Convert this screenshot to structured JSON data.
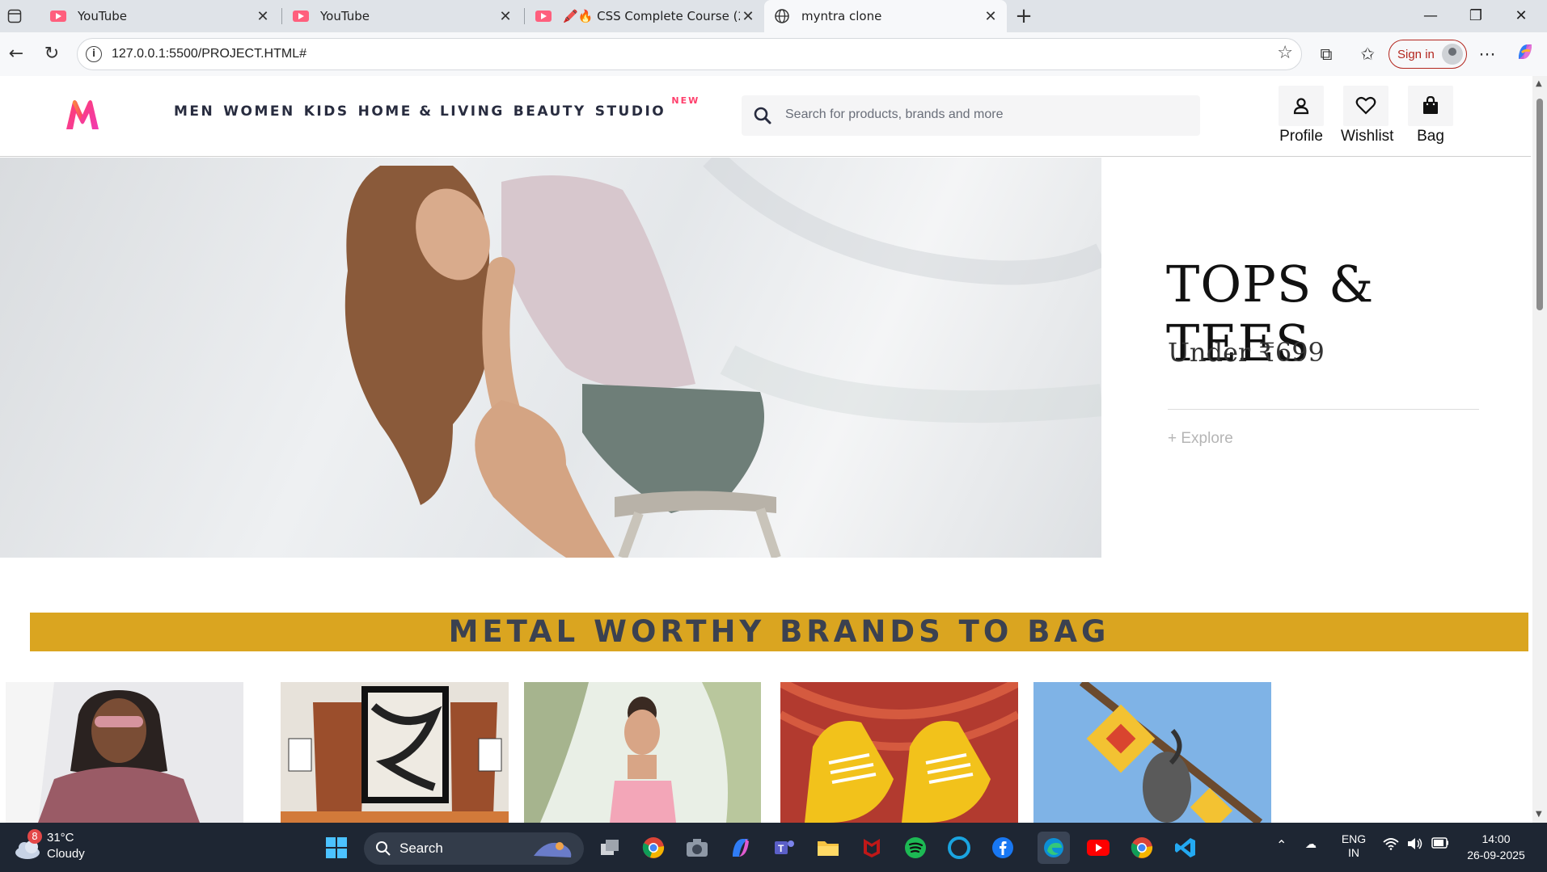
{
  "browser": {
    "tabs": [
      {
        "title": "YouTube",
        "favicon": "youtube-icon"
      },
      {
        "title": "YouTube",
        "favicon": "youtube-icon"
      },
      {
        "title": "🖍️🔥 CSS Complete Course (20…",
        "favicon": "youtube-icon"
      },
      {
        "title": "myntra clone",
        "favicon": "globe-icon",
        "active": true
      }
    ],
    "url": "127.0.0.1:5500/PROJECT.HTML#",
    "signin_label": "Sign in"
  },
  "site": {
    "brand_color": "#ff3f6c",
    "nav": [
      {
        "label": "MEN"
      },
      {
        "label": "WOMEN"
      },
      {
        "label": "KIDS"
      },
      {
        "label": "HOME & LIVING"
      },
      {
        "label": "BEAUTY"
      },
      {
        "label": "STUDIO",
        "badge": "NEW"
      }
    ],
    "search_placeholder": "Search for products, brands and more",
    "actions": [
      {
        "label": "Profile",
        "icon": "person-icon"
      },
      {
        "label": "Wishlist",
        "icon": "heart-icon"
      },
      {
        "label": "Bag",
        "icon": "bag-icon"
      }
    ]
  },
  "hero": {
    "title": "TOPS & TEES",
    "subtitle": "Under ₹699",
    "cta": "+ Explore"
  },
  "section": {
    "title": "METAL WORTHY BRANDS TO BAG",
    "banner_color": "#daa520"
  },
  "taskbar": {
    "weather_temp": "31°C",
    "weather_cond": "Cloudy",
    "weather_badge": "8",
    "search_label": "Search",
    "lang_top": "ENG",
    "lang_bottom": "IN",
    "time": "14:00",
    "date": "26-09-2025"
  }
}
